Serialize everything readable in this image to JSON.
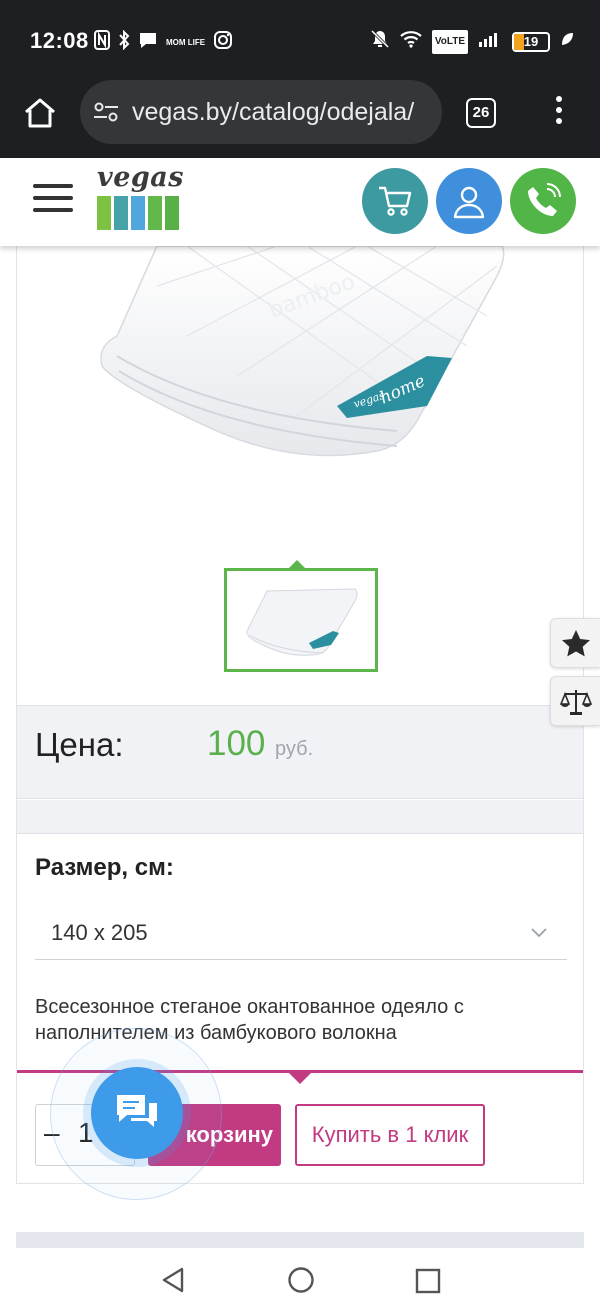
{
  "status_bar": {
    "time": "12:08",
    "battery": "19",
    "volte": "VoLTE",
    "mom_life": "MOM LIFE"
  },
  "browser": {
    "url": "vegas.by/catalog/odejala/",
    "tab_count": "26"
  },
  "header": {
    "logo_text": "vegas",
    "logo_colors": [
      "#6fbf44",
      "#3a9ca3",
      "#4aa0d8",
      "#5bb04b"
    ],
    "cart_color": "#3e9aa1",
    "user_color": "#3f8fdc",
    "phone_color": "#52b548"
  },
  "product": {
    "price_label": "Цена:",
    "price_value": "100",
    "price_currency": "руб.",
    "size_label": "Размер, см:",
    "size_selected": "140 x 205",
    "description": "Всесезонное стеганое окантованное одеяло с наполнителем из бамбукового волокна",
    "quantity": "1",
    "quantity_minus": "–",
    "add_to_cart_label": "корзину",
    "buy_one_click_label": "Купить в 1 клик",
    "image_brand_text": "bamboo",
    "tag_text_1": "vegas",
    "tag_text_2": "home"
  },
  "colors": {
    "accent": "#c13a82",
    "price_green": "#5bb04b",
    "thumb_border": "#5ab54b"
  }
}
